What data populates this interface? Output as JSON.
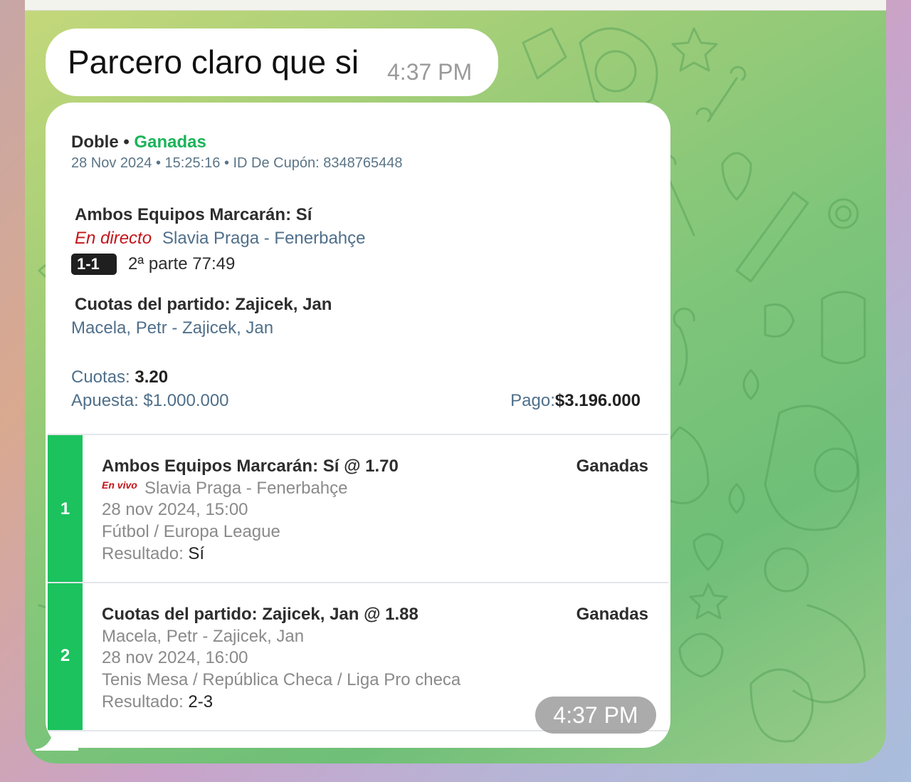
{
  "colors": {
    "won_green": "#1bb45a",
    "leg_bar_green": "#1bc25d",
    "live_red": "#c3141a",
    "link_blue": "#4f6f8a"
  },
  "message": {
    "text": "Parcero claro que si",
    "time": "4:37 PM"
  },
  "ticket": {
    "type": "Doble",
    "separator": "•",
    "status": "Ganadas",
    "meta": "28 Nov 2024 • 15:25:16 • ID De Cupón: 8348765448",
    "selection1": {
      "title": "Ambos Equipos Marcarán: Sí",
      "live_label": "En directo",
      "match": "Slavia Praga - Fenerbahçe",
      "score": "1-1",
      "period": "2ª parte 77:49"
    },
    "selection2": {
      "title": "Cuotas del partido: Zajicek, Jan",
      "match": "Macela, Petr - Zajicek, Jan"
    },
    "odds_label": "Cuotas:",
    "odds_value": "3.20",
    "stake_label": "Apuesta:",
    "stake_value": "$1.000.000",
    "payout_label": "Pago:",
    "payout_value": "$3.196.000"
  },
  "legs": [
    {
      "number": "1",
      "title": "Ambos Equipos Marcarán: Sí @ 1.70",
      "status": "Ganadas",
      "live_label": "En vivo",
      "match": "Slavia Praga - Fenerbahçe",
      "date": "28 nov 2024, 15:00",
      "sport": "Fútbol / Europa League",
      "result_label": "Resultado:",
      "result_value": "Sí"
    },
    {
      "number": "2",
      "title": "Cuotas del partido: Zajicek, Jan @ 1.88",
      "status": "Ganadas",
      "match": "Macela, Petr - Zajicek, Jan",
      "date": "28 nov 2024, 16:00",
      "sport": "Tenis Mesa / República Checa / Liga Pro checa",
      "result_label": "Resultado:",
      "result_value": "2-3"
    }
  ],
  "card_time": "4:37 PM"
}
